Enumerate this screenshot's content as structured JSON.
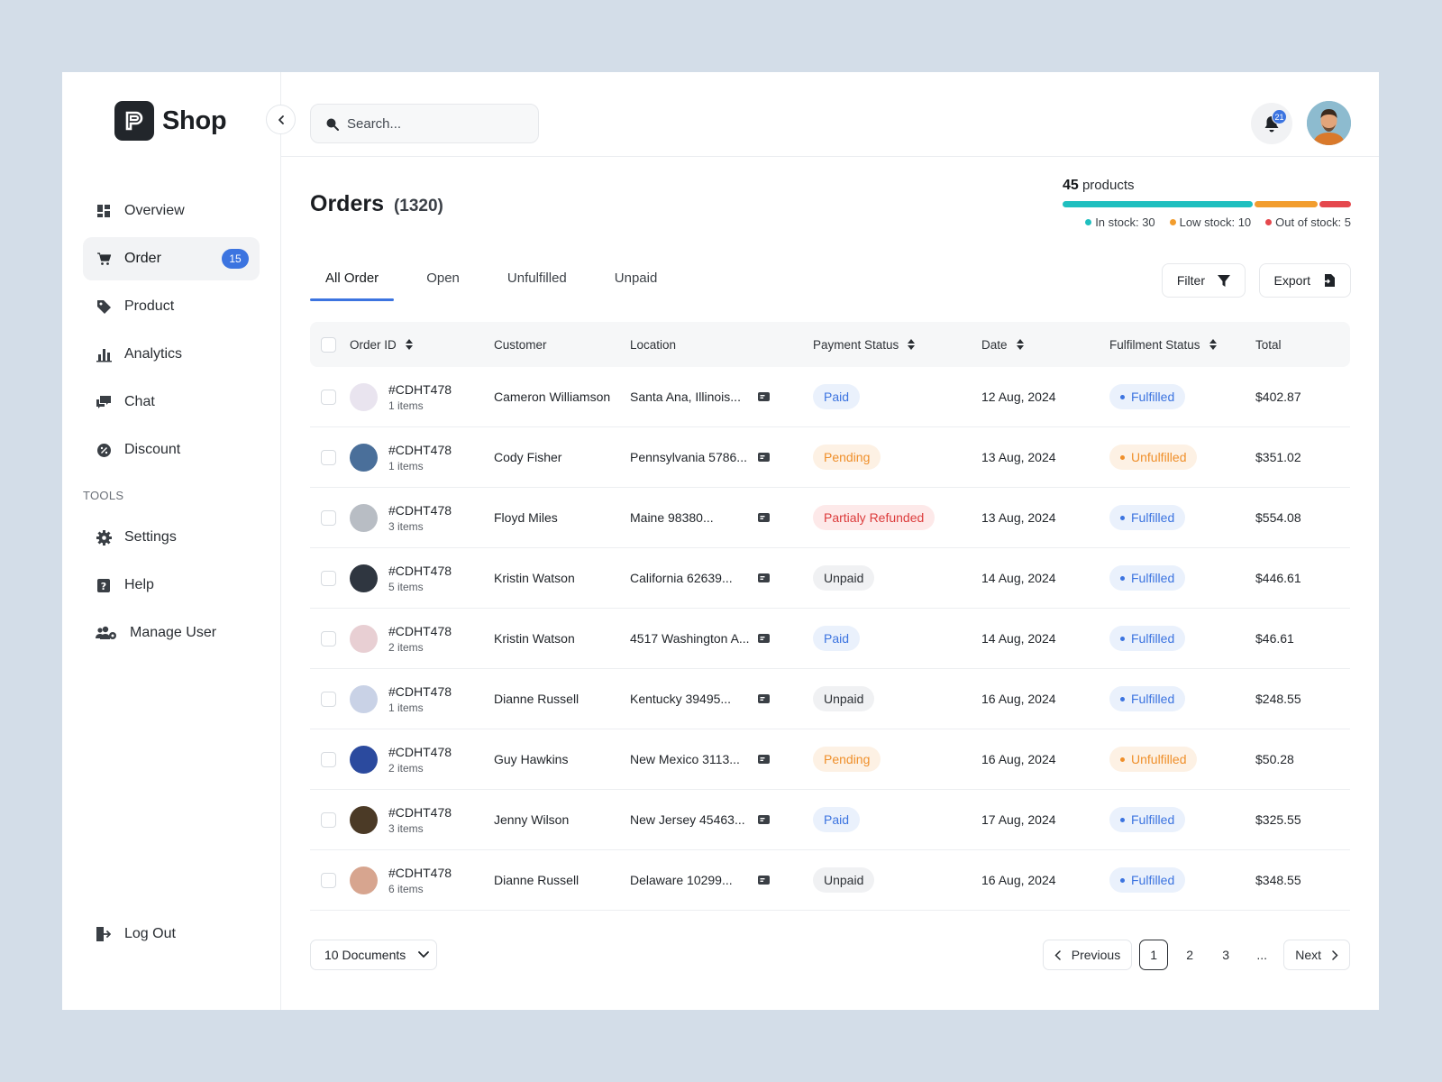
{
  "brand": {
    "name": "Shop"
  },
  "sidebar": {
    "items": [
      {
        "label": "Overview",
        "icon": "grid-icon"
      },
      {
        "label": "Order",
        "icon": "cart-icon",
        "badge": "15",
        "active": true
      },
      {
        "label": "Product",
        "icon": "tag-icon"
      },
      {
        "label": "Analytics",
        "icon": "bar-chart-icon"
      },
      {
        "label": "Chat",
        "icon": "chat-icon"
      },
      {
        "label": "Discount",
        "icon": "discount-icon"
      }
    ],
    "tools_label": "TOOLS",
    "tools": [
      {
        "label": "Settings",
        "icon": "gear-icon"
      },
      {
        "label": "Help",
        "icon": "help-icon"
      },
      {
        "label": "Manage User",
        "icon": "users-icon"
      }
    ],
    "logout_label": "Log Out"
  },
  "header": {
    "search_placeholder": "Search...",
    "notification_count": "21"
  },
  "page": {
    "title": "Orders",
    "count": "(1320)"
  },
  "stock": {
    "count": "45",
    "label": "products",
    "in_stock": 30,
    "low_stock": 10,
    "out_of_stock": 5,
    "in_stock_label": "In stock: 30",
    "low_stock_label": "Low stock: 10",
    "out_of_stock_label": "Out of stock: 5",
    "colors": {
      "in_stock": "#1fbfbf",
      "low_stock": "#f29d2e",
      "out_of_stock": "#e5484d"
    }
  },
  "tabs": [
    "All Order",
    "Open",
    "Unfulfilled",
    "Unpaid"
  ],
  "actions": {
    "filter": "Filter",
    "export": "Export"
  },
  "table": {
    "headers": {
      "order_id": "Order ID",
      "customer": "Customer",
      "location": "Location",
      "payment_status": "Payment Status",
      "date": "Date",
      "fulfilment_status": "Fulfilment Status",
      "total": "Total"
    },
    "rows": [
      {
        "id": "#CDHT478",
        "items": "1 items",
        "thumb": "#e9e4ef",
        "customer": "Cameron Williamson",
        "location": "Santa Ana, Illinois...",
        "payment": "Paid",
        "payment_type": "paid",
        "date": "12 Aug, 2024",
        "fulfilment": "Fulfilled",
        "fulfilment_type": "fulfilled",
        "total": "$402.87"
      },
      {
        "id": "#CDHT478",
        "items": "1 items",
        "thumb": "#4a6f9a",
        "customer": "Cody Fisher",
        "location": "Pennsylvania 5786...",
        "payment": "Pending",
        "payment_type": "pending",
        "date": "13 Aug, 2024",
        "fulfilment": "Unfulfilled",
        "fulfilment_type": "unfulfilled",
        "total": "$351.02"
      },
      {
        "id": "#CDHT478",
        "items": "3 items",
        "thumb": "#b8bdc4",
        "customer": "Floyd Miles",
        "location": "Maine 98380...",
        "payment": "Partialy Refunded",
        "payment_type": "refunded",
        "date": "13 Aug, 2024",
        "fulfilment": "Fulfilled",
        "fulfilment_type": "fulfilled",
        "total": "$554.08"
      },
      {
        "id": "#CDHT478",
        "items": "5 items",
        "thumb": "#2f3640",
        "customer": "Kristin Watson",
        "location": "California 62639...",
        "payment": "Unpaid",
        "payment_type": "unpaid",
        "date": "14 Aug, 2024",
        "fulfilment": "Fulfilled",
        "fulfilment_type": "fulfilled",
        "total": "$446.61"
      },
      {
        "id": "#CDHT478",
        "items": "2 items",
        "thumb": "#e8cfd3",
        "customer": "Kristin Watson",
        "location": "4517 Washington A...",
        "payment": "Paid",
        "payment_type": "paid",
        "date": "14 Aug, 2024",
        "fulfilment": "Fulfilled",
        "fulfilment_type": "fulfilled",
        "total": "$46.61"
      },
      {
        "id": "#CDHT478",
        "items": "1 items",
        "thumb": "#c9d2e6",
        "customer": "Dianne Russell",
        "location": "Kentucky 39495...",
        "payment": "Unpaid",
        "payment_type": "unpaid",
        "date": "16 Aug, 2024",
        "fulfilment": "Fulfilled",
        "fulfilment_type": "fulfilled",
        "total": "$248.55"
      },
      {
        "id": "#CDHT478",
        "items": "2 items",
        "thumb": "#2b4a9e",
        "customer": "Guy Hawkins",
        "location": "New Mexico 3113...",
        "payment": "Pending",
        "payment_type": "pending",
        "date": "16 Aug, 2024",
        "fulfilment": "Unfulfilled",
        "fulfilment_type": "unfulfilled",
        "total": "$50.28"
      },
      {
        "id": "#CDHT478",
        "items": "3 items",
        "thumb": "#4b3a26",
        "customer": "Jenny Wilson",
        "location": "New Jersey 45463...",
        "payment": "Paid",
        "payment_type": "paid",
        "date": "17 Aug, 2024",
        "fulfilment": "Fulfilled",
        "fulfilment_type": "fulfilled",
        "total": "$325.55"
      },
      {
        "id": "#CDHT478",
        "items": "6 items",
        "thumb": "#d7a58f",
        "customer": "Dianne Russell",
        "location": "Delaware 10299...",
        "payment": "Unpaid",
        "payment_type": "unpaid",
        "date": "16 Aug, 2024",
        "fulfilment": "Fulfilled",
        "fulfilment_type": "fulfilled",
        "total": "$348.55"
      }
    ]
  },
  "footer": {
    "documents": "10 Documents",
    "previous": "Previous",
    "next": "Next",
    "pages": [
      "1",
      "2",
      "3",
      "..."
    ]
  }
}
